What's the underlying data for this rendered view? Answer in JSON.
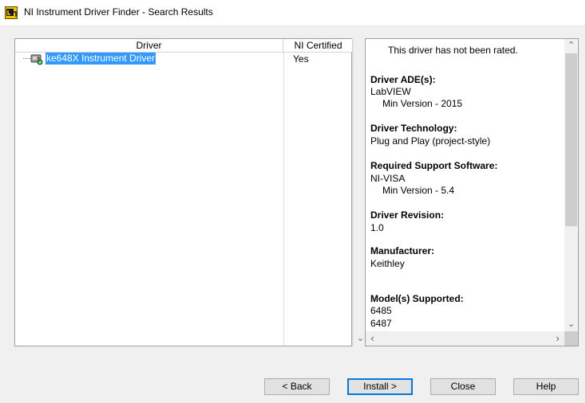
{
  "window": {
    "title": "NI Instrument Driver Finder - Search Results"
  },
  "table": {
    "columns": [
      "Driver",
      "NI Certified"
    ],
    "rows": [
      {
        "driver": "ke648X Instrument Driver",
        "certified": "Yes"
      }
    ]
  },
  "details": {
    "rating": "This driver has not been rated.",
    "ade_label": "Driver ADE(s):",
    "ade_value": "LabVIEW",
    "ade_min": "Min Version - 2015",
    "tech_label": "Driver Technology:",
    "tech_value": "Plug and Play (project-style)",
    "support_label": "Required Support Software:",
    "support_value": "NI-VISA",
    "support_min": "Min Version - 5.4",
    "revision_label": "Driver Revision:",
    "revision_value": "1.0",
    "manufacturer_label": "Manufacturer:",
    "manufacturer_value": "Keithley",
    "models_label": "Model(s) Supported:",
    "models": [
      "6485",
      "6487"
    ]
  },
  "buttons": {
    "back": "< Back",
    "install": "Install >",
    "close": "Close",
    "help": "Help"
  },
  "colors": {
    "selection": "#3399ff",
    "default_button_border": "#0078d7"
  }
}
